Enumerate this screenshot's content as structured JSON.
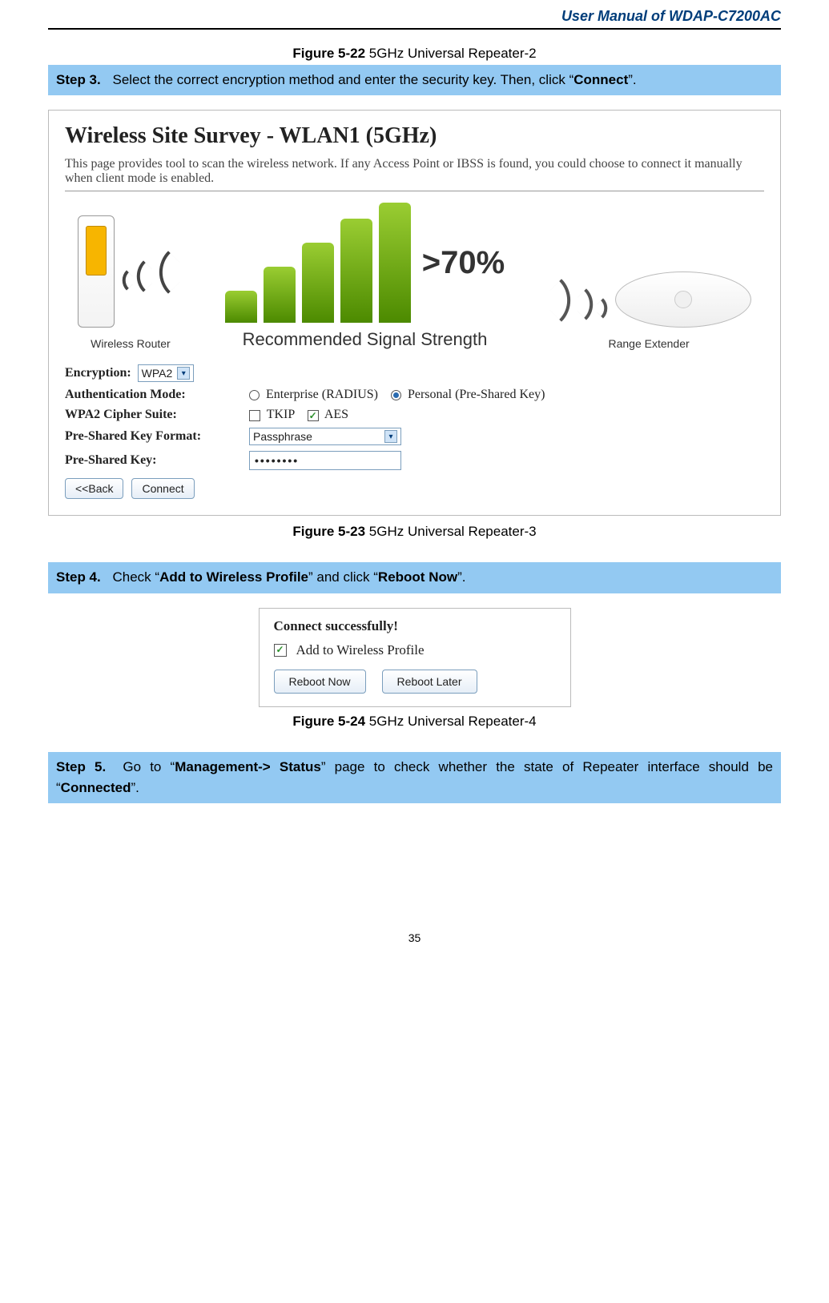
{
  "header": {
    "title": "User Manual of WDAP-C7200AC"
  },
  "captions": {
    "fig22_bold": "Figure 5-22",
    "fig22_rest": " 5GHz Universal Repeater-2",
    "fig23_bold": "Figure 5-23",
    "fig23_rest": " 5GHz Universal Repeater-3",
    "fig24_bold": "Figure 5-24",
    "fig24_rest": " 5GHz Universal Repeater-4"
  },
  "steps": {
    "s3": {
      "label": "Step 3.",
      "pre": "Select the correct encryption method and enter the security key. Then, click “",
      "bold": "Connect",
      "post": "”."
    },
    "s4": {
      "label": "Step 4.",
      "pre": "Check “",
      "b1": "Add to Wireless Profile",
      "mid": "” and click “",
      "b2": "Reboot Now",
      "post": "”."
    },
    "s5": {
      "label": "Step 5.",
      "pre": "Go to “",
      "b1": "Management-> Status",
      "mid": "” page to check whether the state of Repeater interface should be “",
      "b2": "Connected",
      "post": "”."
    }
  },
  "survey": {
    "heading": "Wireless Site Survey - WLAN1 (5GHz)",
    "desc": "This page provides tool to scan the wireless network. If any Access Point or IBSS is found, you could choose to connect it manually when client mode is enabled.",
    "router_label": "Wireless Router",
    "percent": ">70%",
    "rec_label": "Recommended Signal Strength",
    "extender_label": "Range Extender",
    "form": {
      "encryption_label": "Encryption:",
      "encryption_value": "WPA2",
      "auth_label": "Authentication Mode:",
      "auth_opt1": "Enterprise (RADIUS)",
      "auth_opt2": "Personal (Pre-Shared Key)",
      "cipher_label": "WPA2 Cipher Suite:",
      "cipher_opt1": "TKIP",
      "cipher_opt2": "AES",
      "pskfmt_label": "Pre-Shared Key Format:",
      "pskfmt_value": "Passphrase",
      "psk_label": "Pre-Shared Key:",
      "psk_value": "••••••••",
      "back_btn": "<<Back",
      "connect_btn": "Connect"
    }
  },
  "connect": {
    "title": "Connect successfully!",
    "add_profile": "Add to Wireless Profile",
    "reboot_now": "Reboot Now",
    "reboot_later": "Reboot Later"
  },
  "page_num": "35"
}
